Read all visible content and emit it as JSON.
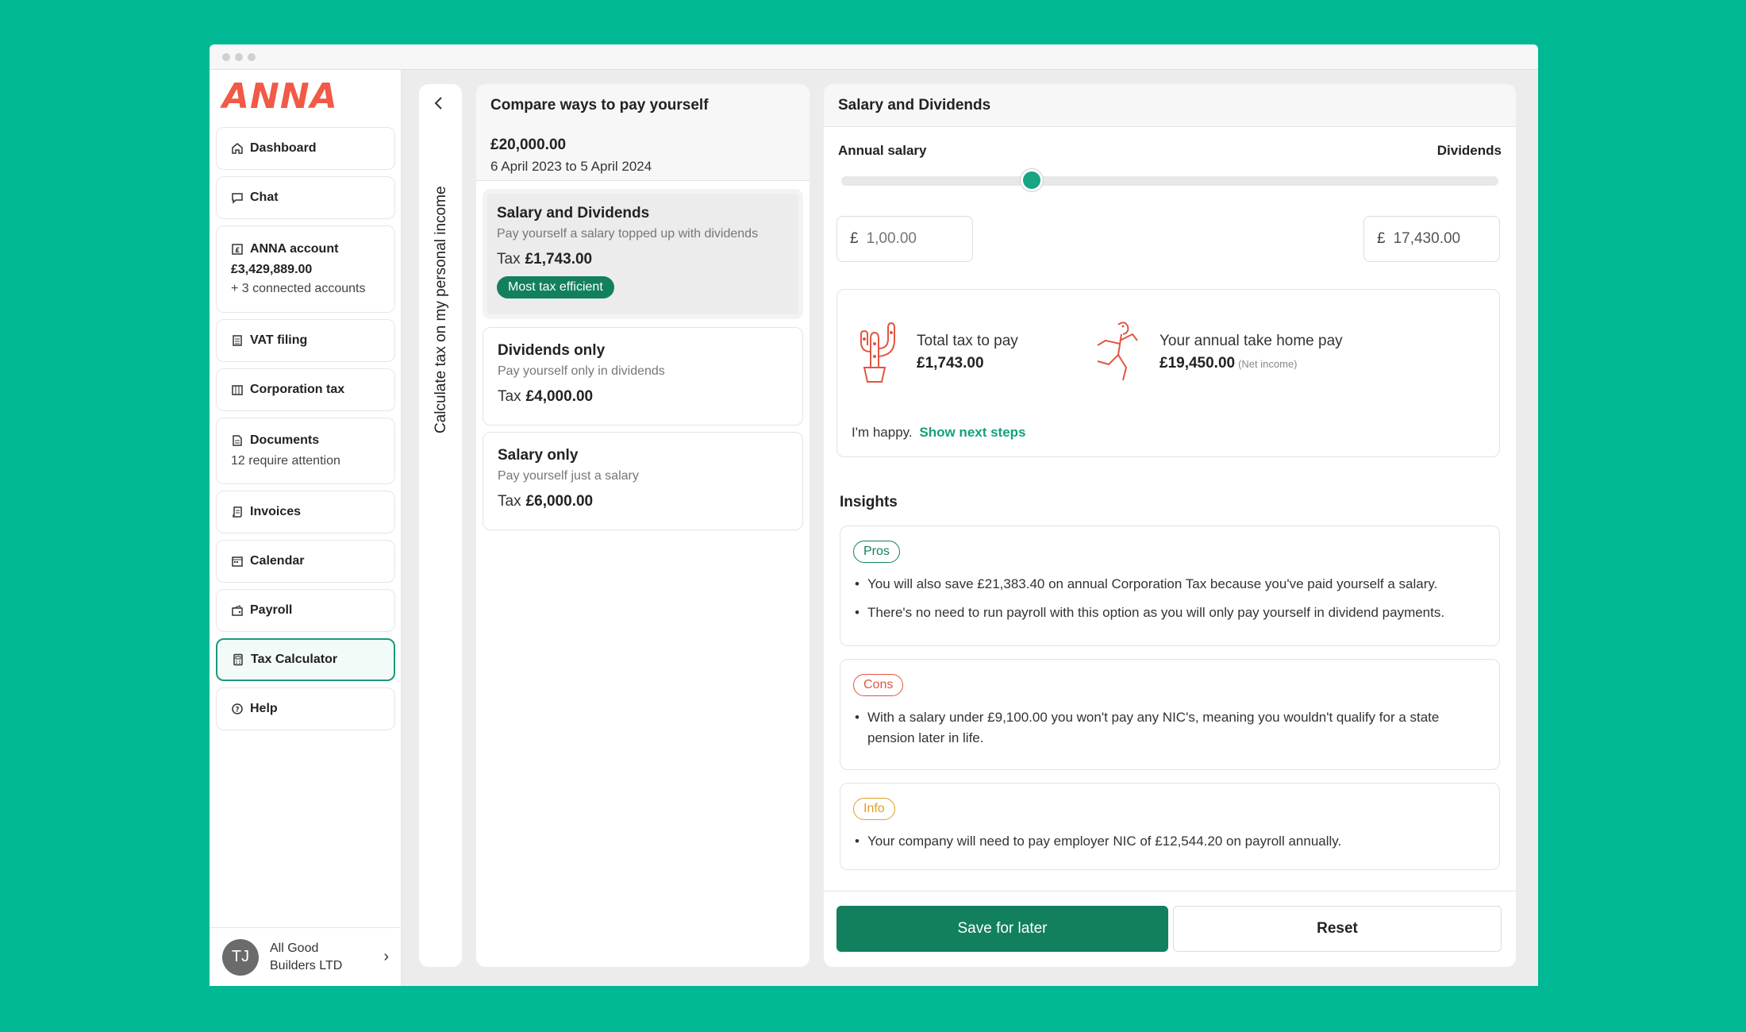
{
  "app": {
    "logo": "ANNA"
  },
  "sidebar": {
    "items": [
      {
        "label": "Dashboard",
        "icon": "home-icon"
      },
      {
        "label": "Chat",
        "icon": "chat-icon"
      },
      {
        "label": "ANNA account",
        "icon": "account-icon",
        "balance": "£3,429,889.00",
        "sub": "+ 3 connected accounts"
      },
      {
        "label": "VAT filing",
        "icon": "vat-icon"
      },
      {
        "label": "Corporation tax",
        "icon": "corporation-tax-icon"
      },
      {
        "label": "Documents",
        "icon": "document-icon",
        "sub": "12 require attention"
      },
      {
        "label": "Invoices",
        "icon": "invoice-icon"
      },
      {
        "label": "Calendar",
        "icon": "calendar-icon"
      },
      {
        "label": "Payroll",
        "icon": "payroll-icon"
      },
      {
        "label": "Tax Calculator",
        "icon": "calculator-icon",
        "active": true
      },
      {
        "label": "Help",
        "icon": "help-icon"
      }
    ],
    "user": {
      "initials": "TJ",
      "company": "All Good Builders LTD"
    }
  },
  "collapse": {
    "label": "Calculate tax on my personal income"
  },
  "compare": {
    "title": "Compare ways to pay yourself",
    "amount": "£20,000.00",
    "period": "6 April 2023 to 5 April 2024",
    "tax_label": "Tax",
    "options": [
      {
        "title": "Salary and Dividends",
        "desc": "Pay yourself a salary topped up with dividends",
        "tax": "£1,743.00",
        "badge": "Most tax efficient"
      },
      {
        "title": "Dividends only",
        "desc": "Pay yourself only in dividends",
        "tax": "£4,000.00"
      },
      {
        "title": "Salary only",
        "desc": "Pay yourself just a salary",
        "tax": "£6,000.00"
      }
    ]
  },
  "main": {
    "title": "Salary and Dividends",
    "slider": {
      "left_label": "Annual salary",
      "right_label": "Dividends",
      "position_fraction": 0.29
    },
    "currency": "£",
    "salary_input": {
      "placeholder": "1,00.00"
    },
    "dividends_input": {
      "value": "17,430.00"
    },
    "summary": {
      "tax_label": "Total tax to pay",
      "tax_value": "£1,743.00",
      "take_home_label": "Your annual take home pay",
      "take_home_value": "£19,450.00",
      "net_note": "(Net income)",
      "happy_text": "I'm happy.",
      "next_steps_link": "Show next steps"
    },
    "insights_title": "Insights",
    "pros": {
      "tag": "Pros",
      "items": [
        "You will also save £21,383.40 on annual Corporation Tax because you've paid yourself a salary.",
        "There's no need to run payroll with this option as you will only pay yourself in dividend payments."
      ]
    },
    "cons": {
      "tag": "Cons",
      "items": [
        "With a salary under £9,100.00 you won't pay any NIC's, meaning you wouldn't qualify for a state pension later in life."
      ]
    },
    "info": {
      "tag": "Info",
      "items": [
        "Your company will need to pay employer NIC of £12,544.20 on payroll annually."
      ]
    },
    "save_button": "Save for later",
    "reset_button": "Reset"
  },
  "colors": {
    "background": "#00b894",
    "brand": "#f05a47",
    "primary": "#12805f",
    "accent": "#19a484"
  }
}
